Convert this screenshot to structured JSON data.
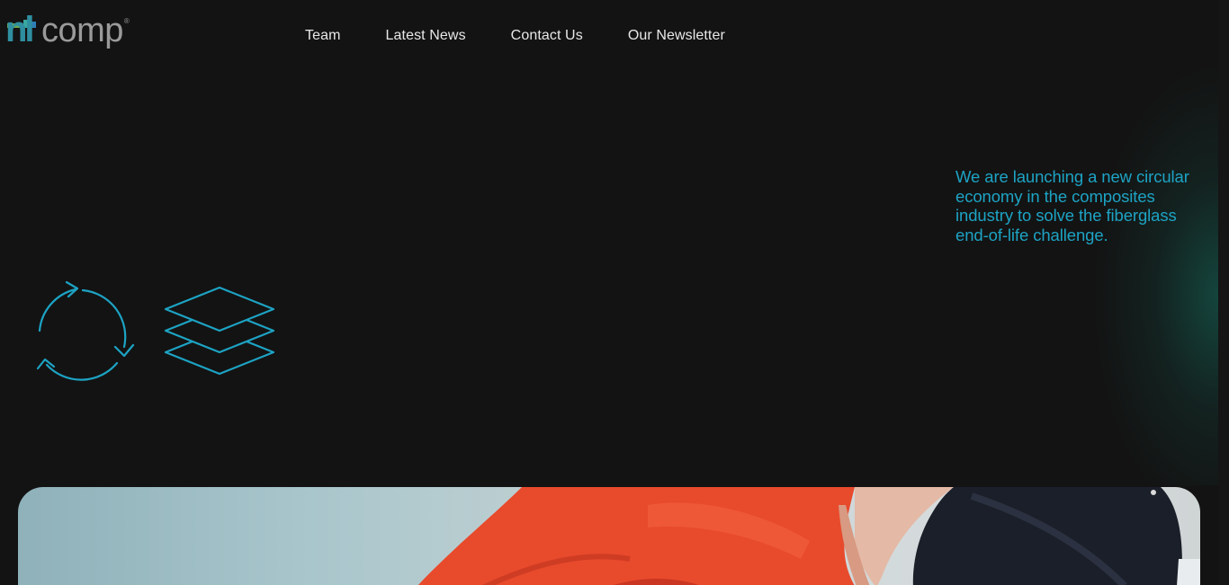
{
  "header": {
    "logo_alt": "nlcomp",
    "logo_word": "comp",
    "logo_mark": "nl",
    "logo_reg": "®",
    "nav": [
      {
        "label": "Team"
      },
      {
        "label": "Latest News"
      },
      {
        "label": "Contact Us"
      },
      {
        "label": "Our Newsletter"
      }
    ]
  },
  "hero_text": {
    "tagline": "We are launching a new circular economy in the composites industry to solve the fiberglass end-of-life challenge."
  },
  "icons": {
    "recycle": "recycle-icon",
    "layers": "layers-icon"
  },
  "colors": {
    "background": "#131313",
    "accent": "#1da3c4",
    "nav_text": "#e8e8e8"
  }
}
